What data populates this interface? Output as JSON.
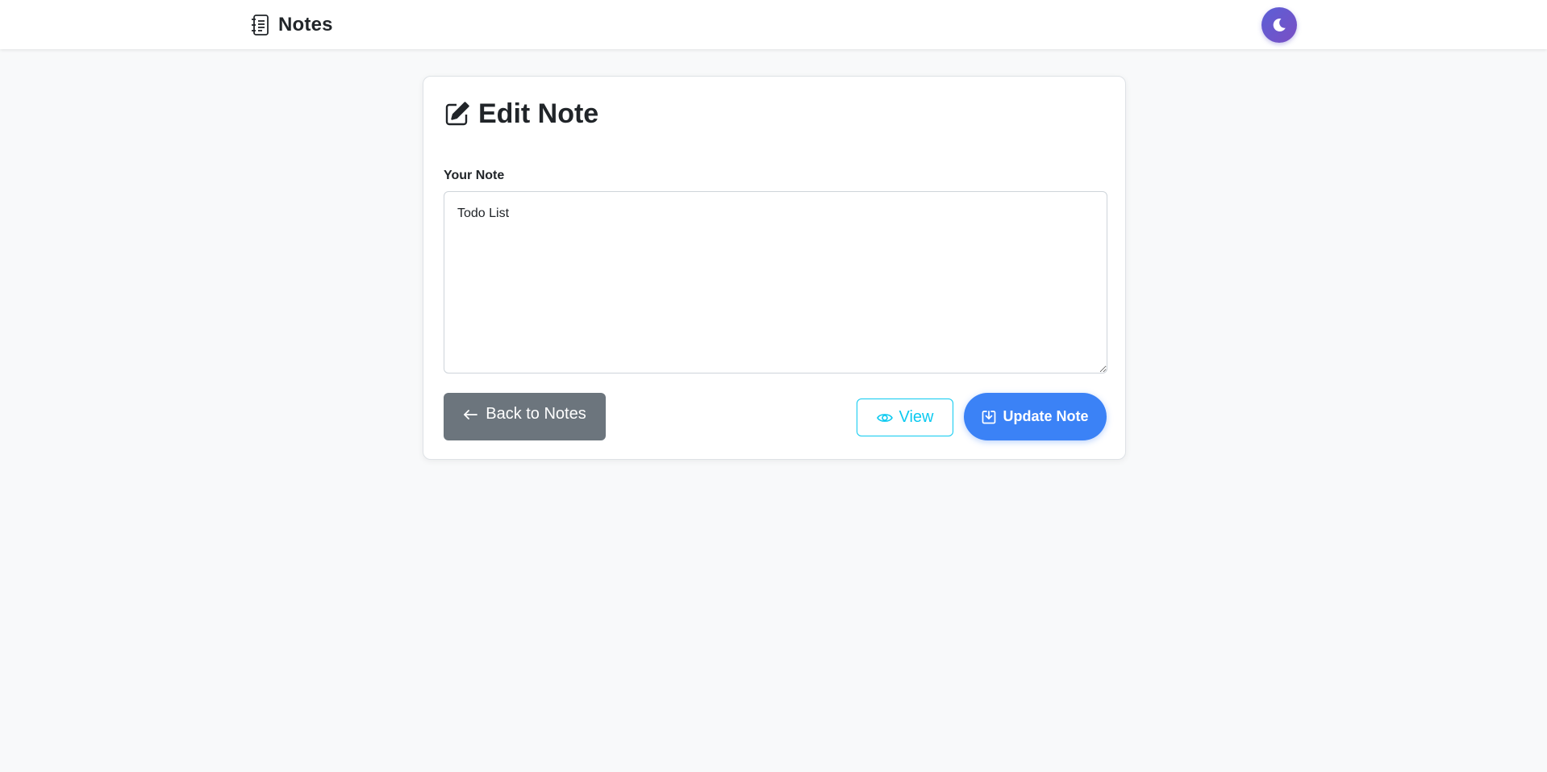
{
  "navbar": {
    "brand_text": "Notes",
    "brand_icon": "journal-text-icon",
    "theme_toggle_icon": "moon-icon"
  },
  "card": {
    "title": "Edit Note",
    "title_icon": "pencil-square-icon",
    "field_label": "Your Note",
    "note_value": "Todo List"
  },
  "buttons": {
    "back_label": "Back to Notes",
    "back_icon": "arrow-left-icon",
    "view_label": "View",
    "view_icon": "eye-icon",
    "update_label": "Update Note",
    "update_icon": "download-box-icon"
  },
  "colors": {
    "page_background": "#f8f9fa",
    "back_button": "#6c757d",
    "view_accent": "#0dcaf0",
    "update_button": "#3b82f6",
    "theme_toggle_gradient": [
      "#5b5fd6",
      "#7a4fc4"
    ]
  }
}
